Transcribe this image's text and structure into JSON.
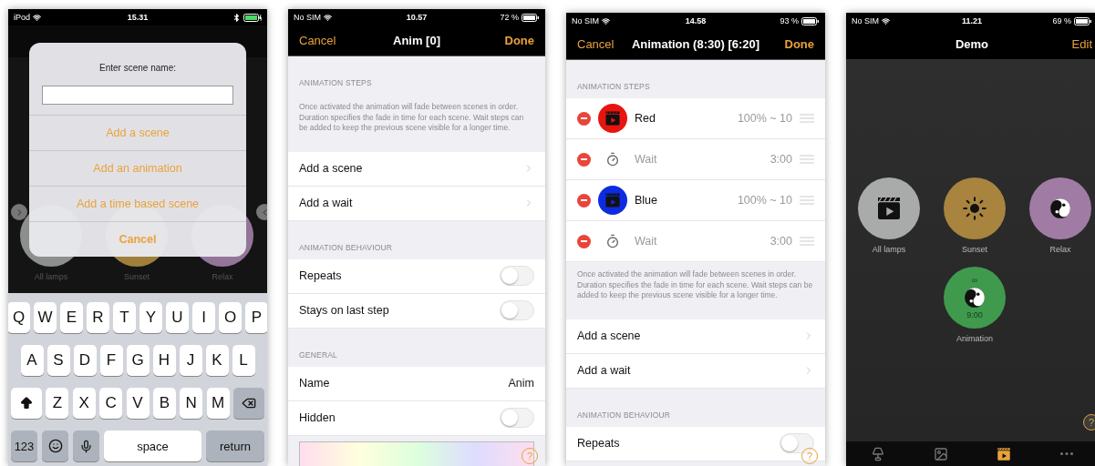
{
  "scene_name_dialog_screen": {
    "status": {
      "carrier": "iPod",
      "time": "15.31",
      "charging": true
    },
    "background_scenes": [
      {
        "name": "All lamps",
        "color": "#8d8f8e"
      },
      {
        "name": "Sunset",
        "color": "#a07f3c"
      },
      {
        "name": "Relax",
        "color": "#94759a"
      }
    ],
    "dialog": {
      "title": "Enter scene name:",
      "buttons": [
        {
          "label": "Add a scene",
          "kind": "action"
        },
        {
          "label": "Add an animation",
          "kind": "action"
        },
        {
          "label": "Add a time based scene",
          "kind": "action"
        },
        {
          "label": "Cancel",
          "kind": "cancel"
        }
      ]
    },
    "keyboard": [
      [
        {
          "kind": "letter",
          "label": "Q"
        },
        {
          "kind": "letter",
          "label": "W"
        },
        {
          "kind": "letter",
          "label": "E"
        },
        {
          "kind": "letter",
          "label": "R"
        },
        {
          "kind": "letter",
          "label": "T"
        },
        {
          "kind": "letter",
          "label": "Y"
        },
        {
          "kind": "letter",
          "label": "U"
        },
        {
          "kind": "letter",
          "label": "I"
        },
        {
          "kind": "letter",
          "label": "O"
        },
        {
          "kind": "letter",
          "label": "P"
        }
      ],
      [
        {
          "kind": "letter",
          "label": "A"
        },
        {
          "kind": "letter",
          "label": "S"
        },
        {
          "kind": "letter",
          "label": "D"
        },
        {
          "kind": "letter",
          "label": "F"
        },
        {
          "kind": "letter",
          "label": "G"
        },
        {
          "kind": "letter",
          "label": "H"
        },
        {
          "kind": "letter",
          "label": "J"
        },
        {
          "kind": "letter",
          "label": "K"
        },
        {
          "kind": "letter",
          "label": "L"
        }
      ],
      [
        {
          "kind": "shift"
        },
        {
          "kind": "letter",
          "label": "Z"
        },
        {
          "kind": "letter",
          "label": "X"
        },
        {
          "kind": "letter",
          "label": "C"
        },
        {
          "kind": "letter",
          "label": "V"
        },
        {
          "kind": "letter",
          "label": "B"
        },
        {
          "kind": "letter",
          "label": "N"
        },
        {
          "kind": "letter",
          "label": "M"
        },
        {
          "kind": "backspace"
        }
      ],
      [
        {
          "kind": "mode",
          "label": "123"
        },
        {
          "kind": "emoji"
        },
        {
          "kind": "mic"
        },
        {
          "kind": "space",
          "label": "space"
        },
        {
          "kind": "return",
          "label": "return"
        }
      ]
    ]
  },
  "animation_editor_screen": {
    "status": {
      "carrier": "No SIM",
      "time": "10.57",
      "battery": "72 %",
      "charging": false
    },
    "nav": {
      "cancel": "Cancel",
      "title": "Anim [0]",
      "done": "Done"
    },
    "items": [
      {
        "kind": "header",
        "text": "ANIMATION STEPS"
      },
      {
        "kind": "note",
        "text": "Once activated the animation will fade between scenes in order. Duration specifies the fade in time for each scene. Wait steps can be added to keep the previous scene visible for a longer time."
      },
      {
        "kind": "link",
        "label": "Add a scene"
      },
      {
        "kind": "link",
        "label": "Add a wait"
      },
      {
        "kind": "header",
        "text": "ANIMATION BEHAVIOUR"
      },
      {
        "kind": "toggle",
        "label": "Repeats",
        "on": false
      },
      {
        "kind": "toggle",
        "label": "Stays on last step",
        "on": false
      },
      {
        "kind": "header",
        "text": "GENERAL"
      },
      {
        "kind": "value",
        "label": "Name",
        "value": "Anim"
      },
      {
        "kind": "toggle",
        "label": "Hidden",
        "on": false
      },
      {
        "kind": "color-picker"
      }
    ],
    "help": "?"
  },
  "animation_steps_screen": {
    "status": {
      "carrier": "No SIM",
      "time": "14.58",
      "battery": "93 %",
      "charging": false
    },
    "nav": {
      "cancel": "Cancel",
      "title": "Animation (8:30) [6:20]",
      "done": "Done"
    },
    "items": [
      {
        "kind": "header",
        "text": "ANIMATION STEPS"
      },
      {
        "kind": "scene-step",
        "label": "Red",
        "value": "100% ~ 10",
        "color": "#e8140f"
      },
      {
        "kind": "wait-step",
        "label": "Wait",
        "value": "3:00"
      },
      {
        "kind": "scene-step",
        "label": "Blue",
        "value": "100% ~ 10",
        "color": "#0d2be0"
      },
      {
        "kind": "wait-step",
        "label": "Wait",
        "value": "3:00"
      },
      {
        "kind": "note",
        "text": "Once activated the animation will fade between scenes in order. Duration specifies the fade in time for each scene. Wait steps can be added to keep the previous scene visible for a longer time."
      },
      {
        "kind": "link",
        "label": "Add a scene"
      },
      {
        "kind": "link",
        "label": "Add a wait"
      },
      {
        "kind": "header",
        "text": "ANIMATION BEHAVIOUR"
      },
      {
        "kind": "toggle",
        "label": "Repeats",
        "on": false
      }
    ],
    "help": "?"
  },
  "scenes_screen": {
    "status": {
      "carrier": "No SIM",
      "time": "11.21",
      "battery": "69 %",
      "charging": false
    },
    "nav": {
      "title": "Demo",
      "edit": "Edit"
    },
    "scenes": [
      {
        "name": "All lamps",
        "color": "#a9abaa",
        "kind": "clapper"
      },
      {
        "name": "Sunset",
        "color": "#a8843f",
        "kind": "sun"
      },
      {
        "name": "Relax",
        "color": "#a07ca5",
        "kind": "yin-yang"
      },
      {
        "name": "Animation",
        "color": "#3f9a4e",
        "kind": "yin-yang",
        "top": "∞",
        "bottom": "9:00"
      }
    ],
    "help": "?",
    "tabs": [
      {
        "kind": "lamp",
        "selected": false
      },
      {
        "kind": "photos",
        "selected": false
      },
      {
        "kind": "clapper",
        "selected": true
      },
      {
        "kind": "more",
        "selected": false
      }
    ]
  }
}
